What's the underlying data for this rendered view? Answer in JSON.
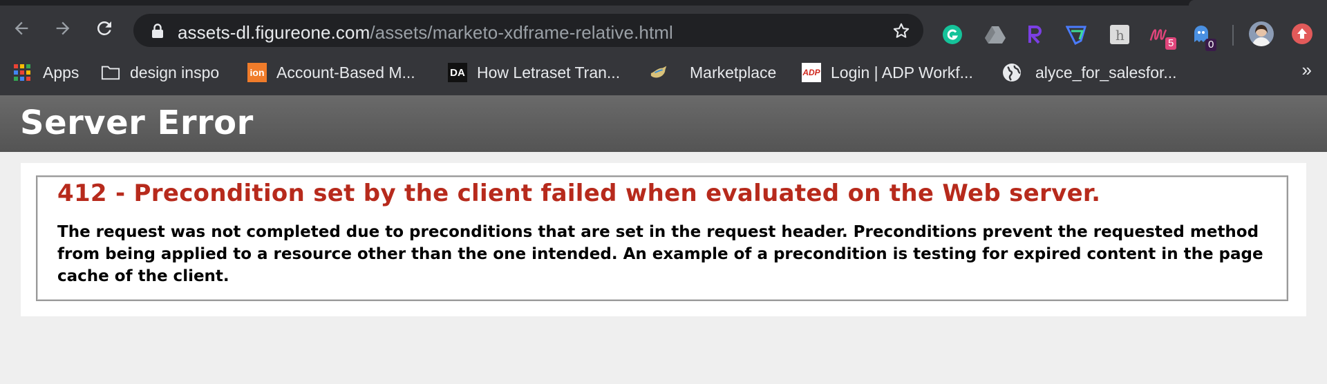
{
  "browser": {
    "url_host": "assets-dl.figureone.com",
    "url_path": "/assets/marketo-xdframe-relative.html",
    "extensions": [
      {
        "name": "grammarly-icon",
        "color": "#15c39a"
      },
      {
        "name": "google-drive-icon",
        "color": "#9aa0a6"
      },
      {
        "name": "r-extension-icon",
        "color": "#7b3fe4"
      },
      {
        "name": "shield-extension-icon",
        "color": "#3ddc97"
      },
      {
        "name": "h-extension-icon",
        "color": "#dcdcdc"
      },
      {
        "name": "m-extension-icon",
        "color": "#e0457b",
        "badge": "5"
      },
      {
        "name": "ghost-extension-icon",
        "color": "#4a90e2",
        "badge": "0"
      },
      {
        "name": "avatar"
      },
      {
        "name": "update-icon",
        "color": "#e25a5a"
      }
    ],
    "bookmarks": [
      {
        "label": "Apps",
        "icon": "apps-grid-icon"
      },
      {
        "label": "design inspo",
        "icon": "folder-icon"
      },
      {
        "label": "Account-Based M...",
        "icon": "ion-favicon",
        "icon_text": "ion"
      },
      {
        "label": "How Letraset Tran...",
        "icon": "da-favicon",
        "icon_text": "DA"
      },
      {
        "label": "Marketplace",
        "icon": "bird-favicon"
      },
      {
        "label": "Login | ADP Workf...",
        "icon": "adp-favicon",
        "icon_text": "ADP"
      },
      {
        "label": "alyce_for_salesfor...",
        "icon": "globe-icon"
      }
    ]
  },
  "page": {
    "header_title": "Server Error",
    "error_title": "412 - Precondition set by the client failed when evaluated on the Web server.",
    "error_description": "The request was not completed due to preconditions that are set in the request header. Preconditions prevent the requested method from being applied to a resource other than the one intended. An example of a precondition is testing for expired content in the page cache of the client."
  },
  "colors": {
    "chrome_bg": "#35363a",
    "omnibox_bg": "#202124",
    "header_bar": "#5e5e5e",
    "error_red": "#b72a1c"
  }
}
